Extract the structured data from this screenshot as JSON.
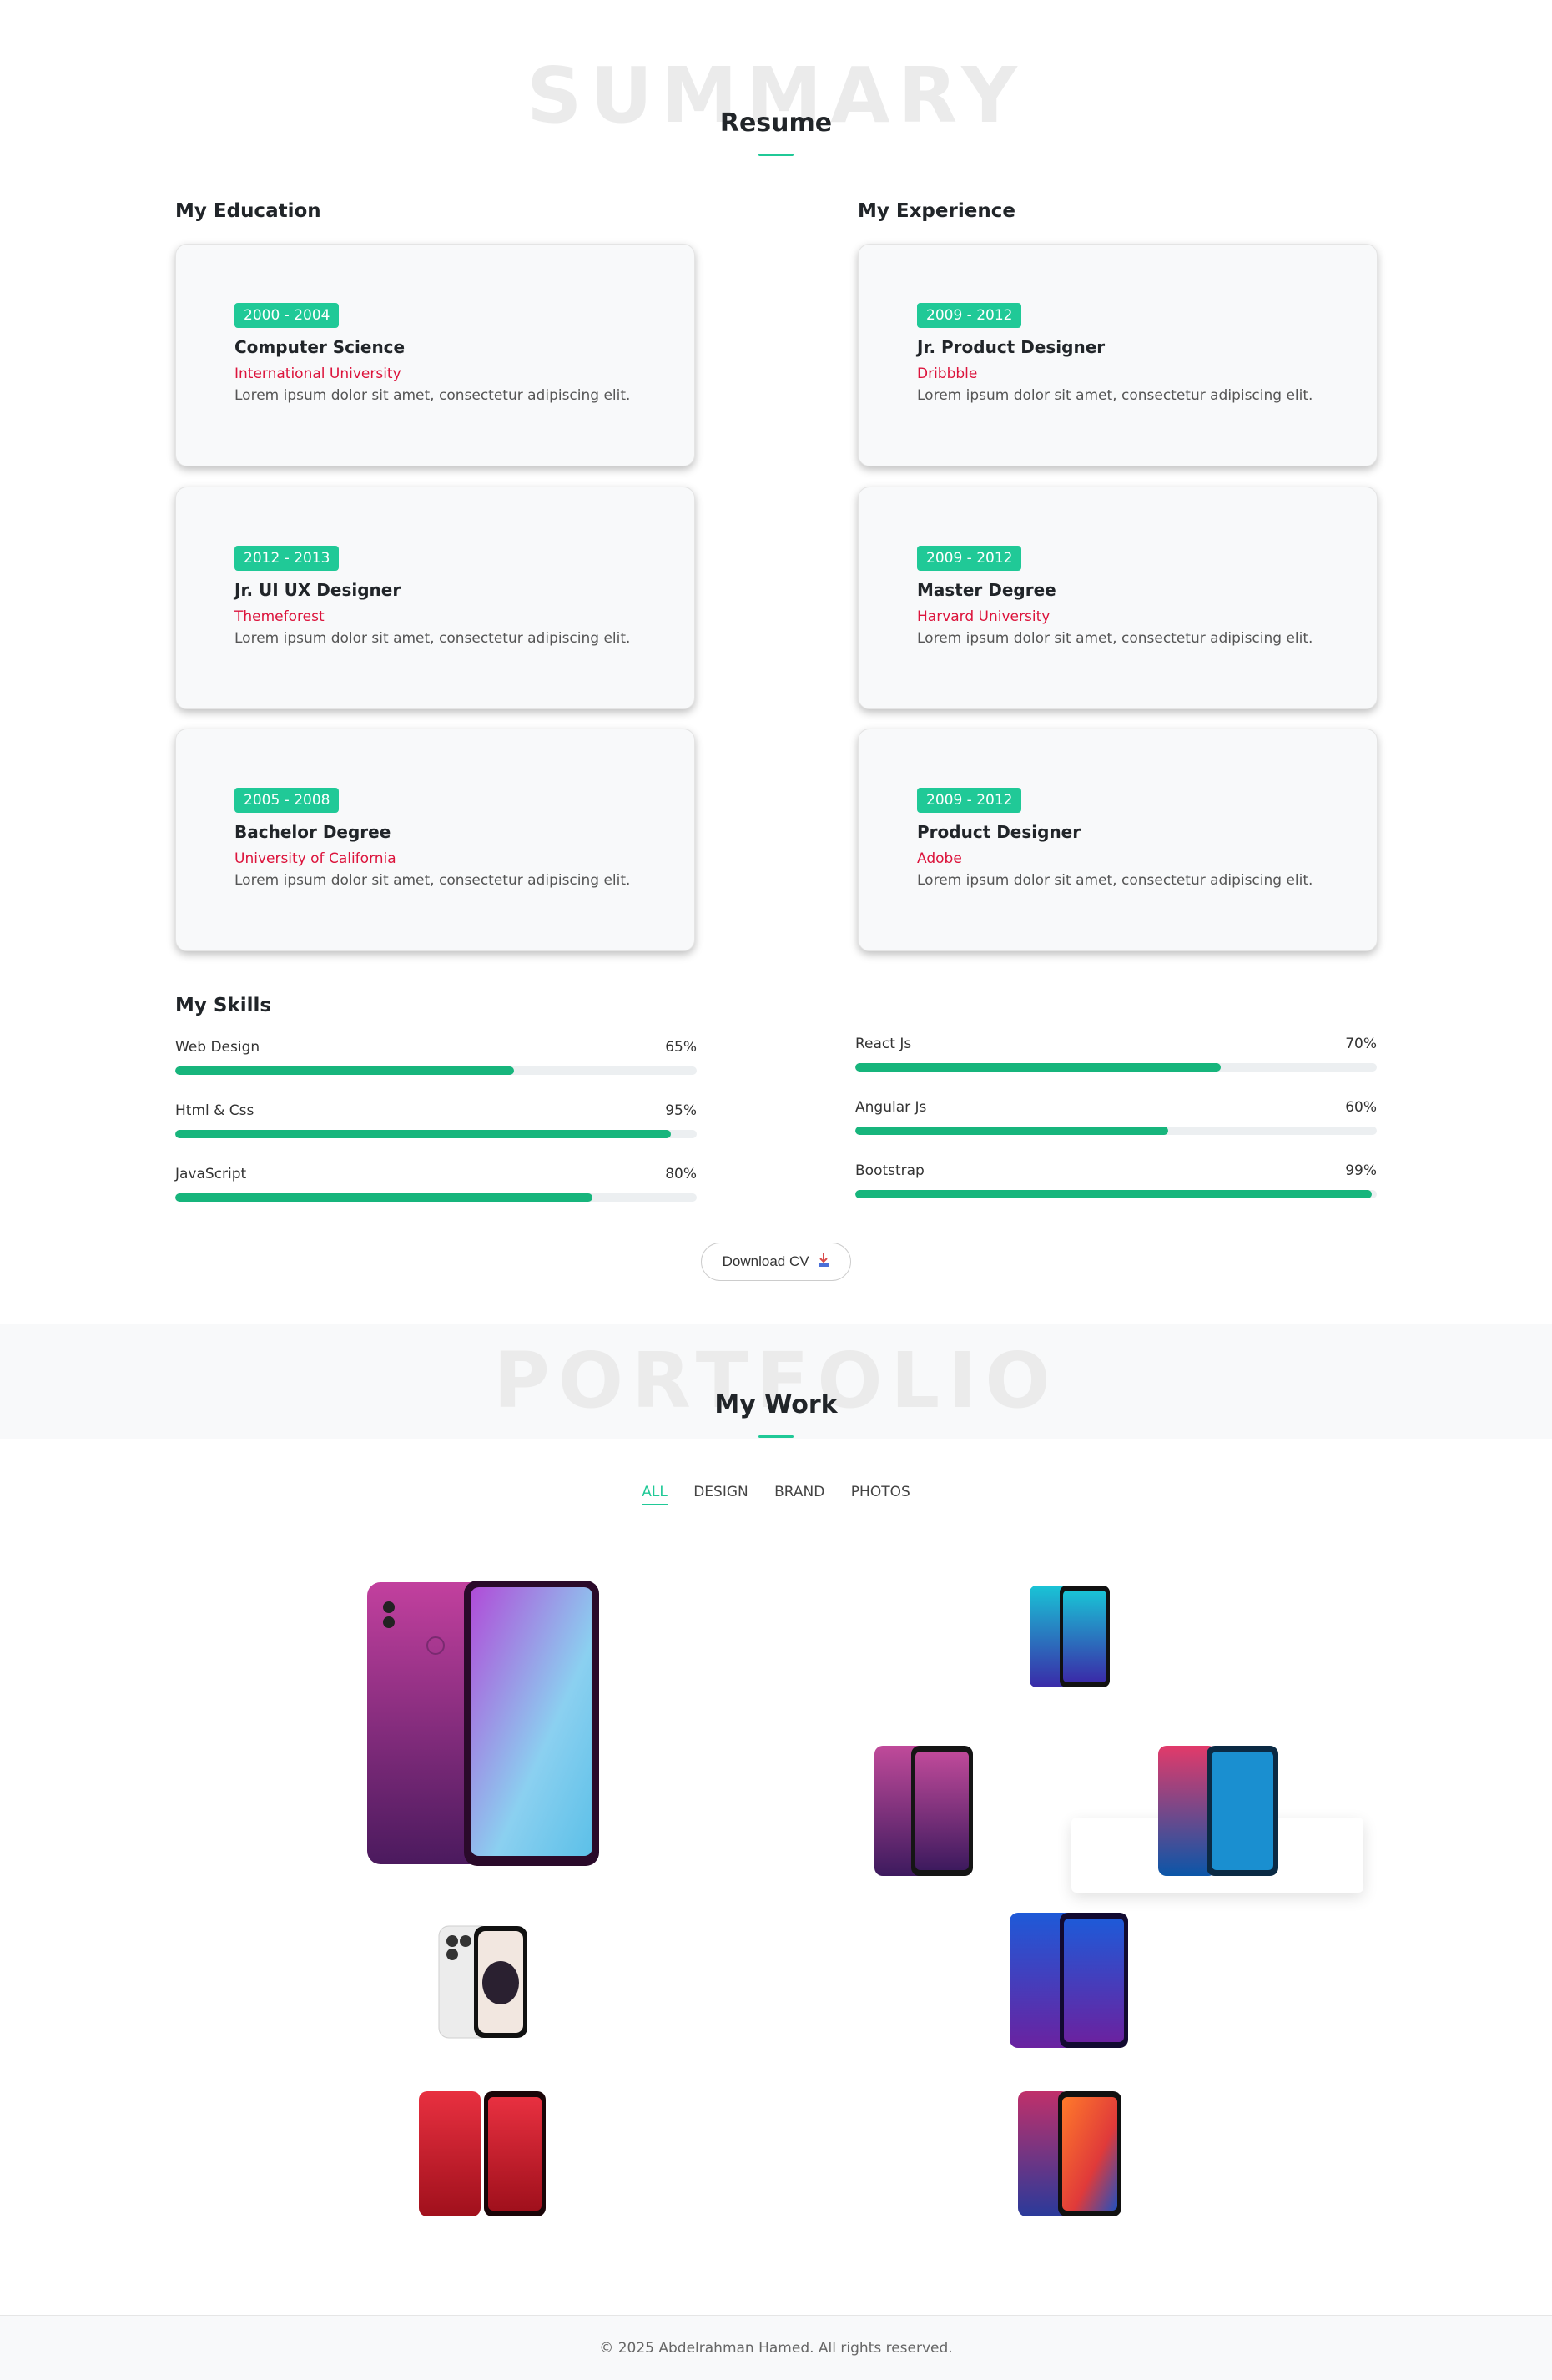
{
  "summary": {
    "bg_word": "SUMMARY",
    "title": "Resume"
  },
  "education": {
    "heading": "My Education",
    "items": [
      {
        "years": "2000 - 2004",
        "title": "Computer Science",
        "org": "International University",
        "desc": "Lorem ipsum dolor sit amet, consectetur adipiscing elit."
      },
      {
        "years": "2012 - 2013",
        "title": "Jr. UI UX Designer",
        "org": "Themeforest",
        "desc": "Lorem ipsum dolor sit amet, consectetur adipiscing elit."
      },
      {
        "years": "2005 - 2008",
        "title": "Bachelor Degree",
        "org": "University of California",
        "desc": "Lorem ipsum dolor sit amet, consectetur adipiscing elit."
      }
    ]
  },
  "experience": {
    "heading": "My Experience",
    "items": [
      {
        "years": "2009 - 2012",
        "title": "Jr. Product Designer",
        "org": "Dribbble",
        "desc": "Lorem ipsum dolor sit amet, consectetur adipiscing elit."
      },
      {
        "years": "2009 - 2012",
        "title": "Master Degree",
        "org": "Harvard University",
        "desc": "Lorem ipsum dolor sit amet, consectetur adipiscing elit."
      },
      {
        "years": "2009 - 2012",
        "title": "Product Designer",
        "org": "Adobe",
        "desc": "Lorem ipsum dolor sit amet, consectetur adipiscing elit."
      }
    ]
  },
  "skills": {
    "heading": "My Skills",
    "left": [
      {
        "name": "Web Design",
        "percent_label": "65%",
        "percent": 65
      },
      {
        "name": "Html & Css",
        "percent_label": "95%",
        "percent": 95
      },
      {
        "name": "JavaScript",
        "percent_label": "80%",
        "percent": 80
      }
    ],
    "right": [
      {
        "name": "React Js",
        "percent_label": "70%",
        "percent": 70
      },
      {
        "name": "Angular Js",
        "percent_label": "60%",
        "percent": 60
      },
      {
        "name": "Bootstrap",
        "percent_label": "99%",
        "percent": 99
      }
    ]
  },
  "download_cv": {
    "label": "Download CV",
    "icon": "download-icon"
  },
  "portfolio": {
    "bg_word": "PORTFOLIO",
    "title": "My Work",
    "filters": [
      {
        "label": "ALL",
        "active": true
      },
      {
        "label": "DESIGN",
        "active": false
      },
      {
        "label": "BRAND",
        "active": false
      },
      {
        "label": "PHOTOS",
        "active": false
      }
    ],
    "items": [
      "phone-image",
      "phone-image",
      "phone-image",
      "phone-image",
      "phone-image",
      "phone-image",
      "phone-image",
      "phone-image"
    ]
  },
  "colors": {
    "accent": "#20c997",
    "org": "#dc143c",
    "bar": "#17b57c"
  },
  "footer": {
    "text": "© 2025 Abdelrahman Hamed. All rights reserved."
  }
}
